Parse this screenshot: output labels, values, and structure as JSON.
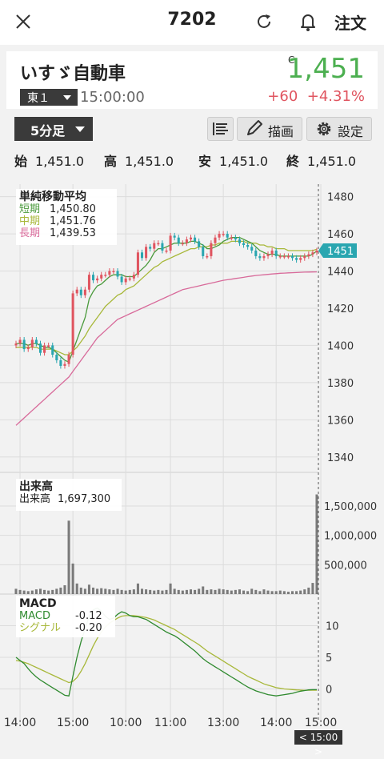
{
  "header": {
    "title": "7202",
    "order_label": "注文"
  },
  "quote": {
    "name": "いすゞ自動車",
    "exchange": "東１",
    "time": "15:00:00",
    "flag": "C",
    "price": "1,451",
    "change": "+60",
    "change_pct": "+4.31%"
  },
  "controls": {
    "period": "5分足",
    "draw_label": "描画",
    "settings_label": "設定"
  },
  "ohlc": [
    {
      "label": "始",
      "value": "1,451.0"
    },
    {
      "label": "高",
      "value": "1,451.0"
    },
    {
      "label": "安",
      "value": "1,451.0"
    },
    {
      "label": "終",
      "value": "1,451.0"
    }
  ],
  "price_legend": {
    "title": "単純移動平均",
    "rows": [
      {
        "name": "短期",
        "value": "1,450.80",
        "color": "#4a9a3c"
      },
      {
        "name": "中期",
        "value": "1,451.76",
        "color": "#a8b83a"
      },
      {
        "name": "長期",
        "value": "1,439.53",
        "color": "#d86a9a"
      }
    ]
  },
  "volume_legend": {
    "title": "出来高",
    "name": "出来高",
    "value": "1,697,300"
  },
  "macd_legend": {
    "title": "MACD",
    "rows": [
      {
        "name": "MACD",
        "value": "-0.12",
        "color": "#2f8a2f"
      },
      {
        "name": "シグナル",
        "value": "-0.20",
        "color": "#a8b83a"
      }
    ]
  },
  "last_price_tag": "1451",
  "crosshair_time": "< 15:00 >",
  "colors": {
    "up": "#e05560",
    "down": "#2aa6b0",
    "price_up": "#4caf50"
  },
  "chart_data": [
    {
      "type": "candlestick",
      "ylim": [
        1330,
        1485
      ],
      "yticks": [
        1340,
        1360,
        1380,
        1400,
        1420,
        1440,
        1460,
        1480
      ],
      "xticks": [
        "14:00",
        "15:00",
        "10:00",
        "11:00",
        "13:00",
        "14:00",
        "15:00"
      ],
      "xtick_index": [
        1,
        14,
        27,
        38,
        51,
        64,
        75
      ],
      "close": [
        1401,
        1403,
        1398,
        1399,
        1403,
        1401,
        1396,
        1400,
        1400,
        1395,
        1392,
        1389,
        1390,
        1395,
        1428,
        1430,
        1427,
        1430,
        1438,
        1435,
        1436,
        1438,
        1438,
        1440,
        1440,
        1437,
        1434,
        1436,
        1436,
        1438,
        1450,
        1447,
        1453,
        1452,
        1455,
        1455,
        1451,
        1451,
        1459,
        1458,
        1455,
        1455,
        1457,
        1458,
        1456,
        1453,
        1448,
        1448,
        1455,
        1458,
        1460,
        1460,
        1458,
        1458,
        1457,
        1455,
        1454,
        1453,
        1451,
        1448,
        1447,
        1448,
        1449,
        1451,
        1448,
        1448,
        1448,
        1448,
        1447,
        1446,
        1447,
        1448,
        1449,
        1450,
        1451
      ],
      "ma_short": [
        1401,
        1401,
        1401,
        1400,
        1401,
        1401,
        1400,
        1399,
        1399,
        1398,
        1396,
        1394,
        1392,
        1391,
        1397,
        1403,
        1409,
        1415,
        1425,
        1429,
        1432,
        1433,
        1435,
        1437,
        1438,
        1438,
        1438,
        1437,
        1437,
        1437,
        1439,
        1441,
        1443,
        1446,
        1450,
        1452,
        1452,
        1453,
        1454,
        1455,
        1455,
        1455,
        1455,
        1456,
        1456,
        1455,
        1454,
        1452,
        1452,
        1453,
        1454,
        1456,
        1457,
        1458,
        1458,
        1458,
        1457,
        1456,
        1455,
        1453,
        1451,
        1450,
        1449,
        1449,
        1449,
        1448,
        1448,
        1448,
        1448,
        1448,
        1448,
        1448,
        1448,
        1449,
        1450.8
      ],
      "ma_mid": [
        1399,
        1399,
        1399,
        1399,
        1399,
        1399,
        1398,
        1398,
        1398,
        1398,
        1397,
        1396,
        1395,
        1395,
        1397,
        1399,
        1402,
        1405,
        1409,
        1412,
        1415,
        1418,
        1421,
        1423,
        1425,
        1427,
        1428,
        1430,
        1431,
        1432,
        1434,
        1436,
        1438,
        1440,
        1442,
        1443,
        1445,
        1446,
        1447,
        1448,
        1449,
        1450,
        1451,
        1452,
        1452,
        1453,
        1453,
        1453,
        1454,
        1454,
        1455,
        1455,
        1455,
        1456,
        1456,
        1456,
        1456,
        1455,
        1455,
        1455,
        1454,
        1454,
        1453,
        1453,
        1452,
        1452,
        1452,
        1451,
        1451,
        1451,
        1451,
        1451,
        1451,
        1451,
        1451.76
      ],
      "ma_long": [
        1357,
        1359,
        1361,
        1363,
        1365,
        1367,
        1369,
        1371,
        1373,
        1375,
        1377,
        1379,
        1381,
        1383,
        1386,
        1389,
        1392,
        1395,
        1398,
        1401,
        1404,
        1406,
        1408,
        1410,
        1412,
        1414,
        1415,
        1416,
        1417,
        1418,
        1419,
        1420,
        1421,
        1422,
        1423,
        1424,
        1425,
        1426,
        1427,
        1428,
        1429,
        1430,
        1430.5,
        1431,
        1431.5,
        1432,
        1432.5,
        1433,
        1433.5,
        1434,
        1434.5,
        1435,
        1435.3,
        1435.6,
        1436,
        1436.3,
        1436.6,
        1437,
        1437.3,
        1437.6,
        1437.8,
        1438,
        1438.2,
        1438.4,
        1438.6,
        1438.8,
        1438.9,
        1439,
        1439.1,
        1439.2,
        1439.3,
        1439.4,
        1439.45,
        1439.5,
        1439.53
      ]
    },
    {
      "type": "bar",
      "title": "出来高",
      "ylim": [
        0,
        1800000
      ],
      "yticks": [
        500000,
        1000000,
        1500000
      ],
      "ytick_labels": [
        "500,000",
        "1,000,000",
        "1,500,000"
      ],
      "values": [
        90000,
        70000,
        60000,
        50000,
        60000,
        80000,
        90000,
        70000,
        60000,
        70000,
        90000,
        110000,
        150000,
        1250000,
        520000,
        180000,
        110000,
        90000,
        160000,
        110000,
        90000,
        100000,
        90000,
        80000,
        70000,
        90000,
        70000,
        60000,
        70000,
        80000,
        180000,
        90000,
        80000,
        70000,
        60000,
        70000,
        60000,
        70000,
        180000,
        90000,
        70000,
        60000,
        70000,
        80000,
        70000,
        90000,
        130000,
        70000,
        80000,
        70000,
        90000,
        80000,
        70000,
        60000,
        70000,
        80000,
        60000,
        50000,
        90000,
        70000,
        50000,
        80000,
        60000,
        50000,
        50000,
        60000,
        50000,
        40000,
        50000,
        50000,
        60000,
        80000,
        110000,
        190000,
        1697300
      ]
    },
    {
      "type": "line",
      "title": "MACD",
      "ylim": [
        -5,
        15
      ],
      "yticks": [
        0,
        5,
        10
      ],
      "series": [
        {
          "name": "MACD",
          "values": [
            5.0,
            4.5,
            4.0,
            3.2,
            2.5,
            1.9,
            1.4,
            1.0,
            0.6,
            0.2,
            -0.2,
            -0.6,
            -1.0,
            -1.1,
            2.0,
            5.0,
            7.5,
            9.5,
            11.5,
            12.5,
            12.8,
            12.3,
            11.5,
            11.0,
            11.2,
            11.8,
            12.2,
            12.0,
            11.6,
            11.4,
            11.4,
            11.2,
            11.0,
            10.6,
            10.2,
            9.8,
            9.4,
            9.0,
            8.7,
            8.4,
            8.0,
            7.5,
            7.0,
            6.5,
            6.0,
            5.4,
            4.8,
            4.3,
            3.9,
            3.5,
            3.1,
            2.7,
            2.3,
            1.9,
            1.5,
            1.1,
            0.7,
            0.3,
            0,
            -0.3,
            -0.5,
            -0.7,
            -0.9,
            -1.0,
            -1.1,
            -1.0,
            -0.9,
            -0.8,
            -0.7,
            -0.5,
            -0.35,
            -0.25,
            -0.15,
            -0.12,
            -0.12
          ]
        },
        {
          "name": "シグナル",
          "values": [
            4.5,
            4.4,
            4.2,
            4.0,
            3.7,
            3.4,
            3.1,
            2.8,
            2.5,
            2.2,
            1.9,
            1.6,
            1.3,
            1.0,
            1.2,
            1.8,
            2.8,
            4.0,
            5.4,
            6.8,
            8.0,
            9.0,
            9.8,
            10.4,
            10.8,
            11.2,
            11.5,
            11.6,
            11.6,
            11.6,
            11.5,
            11.4,
            11.3,
            11.1,
            10.9,
            10.6,
            10.3,
            10.0,
            9.7,
            9.4,
            9.0,
            8.6,
            8.2,
            7.8,
            7.4,
            7.0,
            6.5,
            6.0,
            5.6,
            5.2,
            4.8,
            4.4,
            4.0,
            3.6,
            3.2,
            2.8,
            2.4,
            2.0,
            1.7,
            1.4,
            1.1,
            0.8,
            0.6,
            0.4,
            0.2,
            0.1,
            0,
            -0.05,
            -0.1,
            -0.15,
            -0.18,
            -0.2,
            -0.2,
            -0.2,
            -0.2
          ]
        }
      ]
    }
  ]
}
